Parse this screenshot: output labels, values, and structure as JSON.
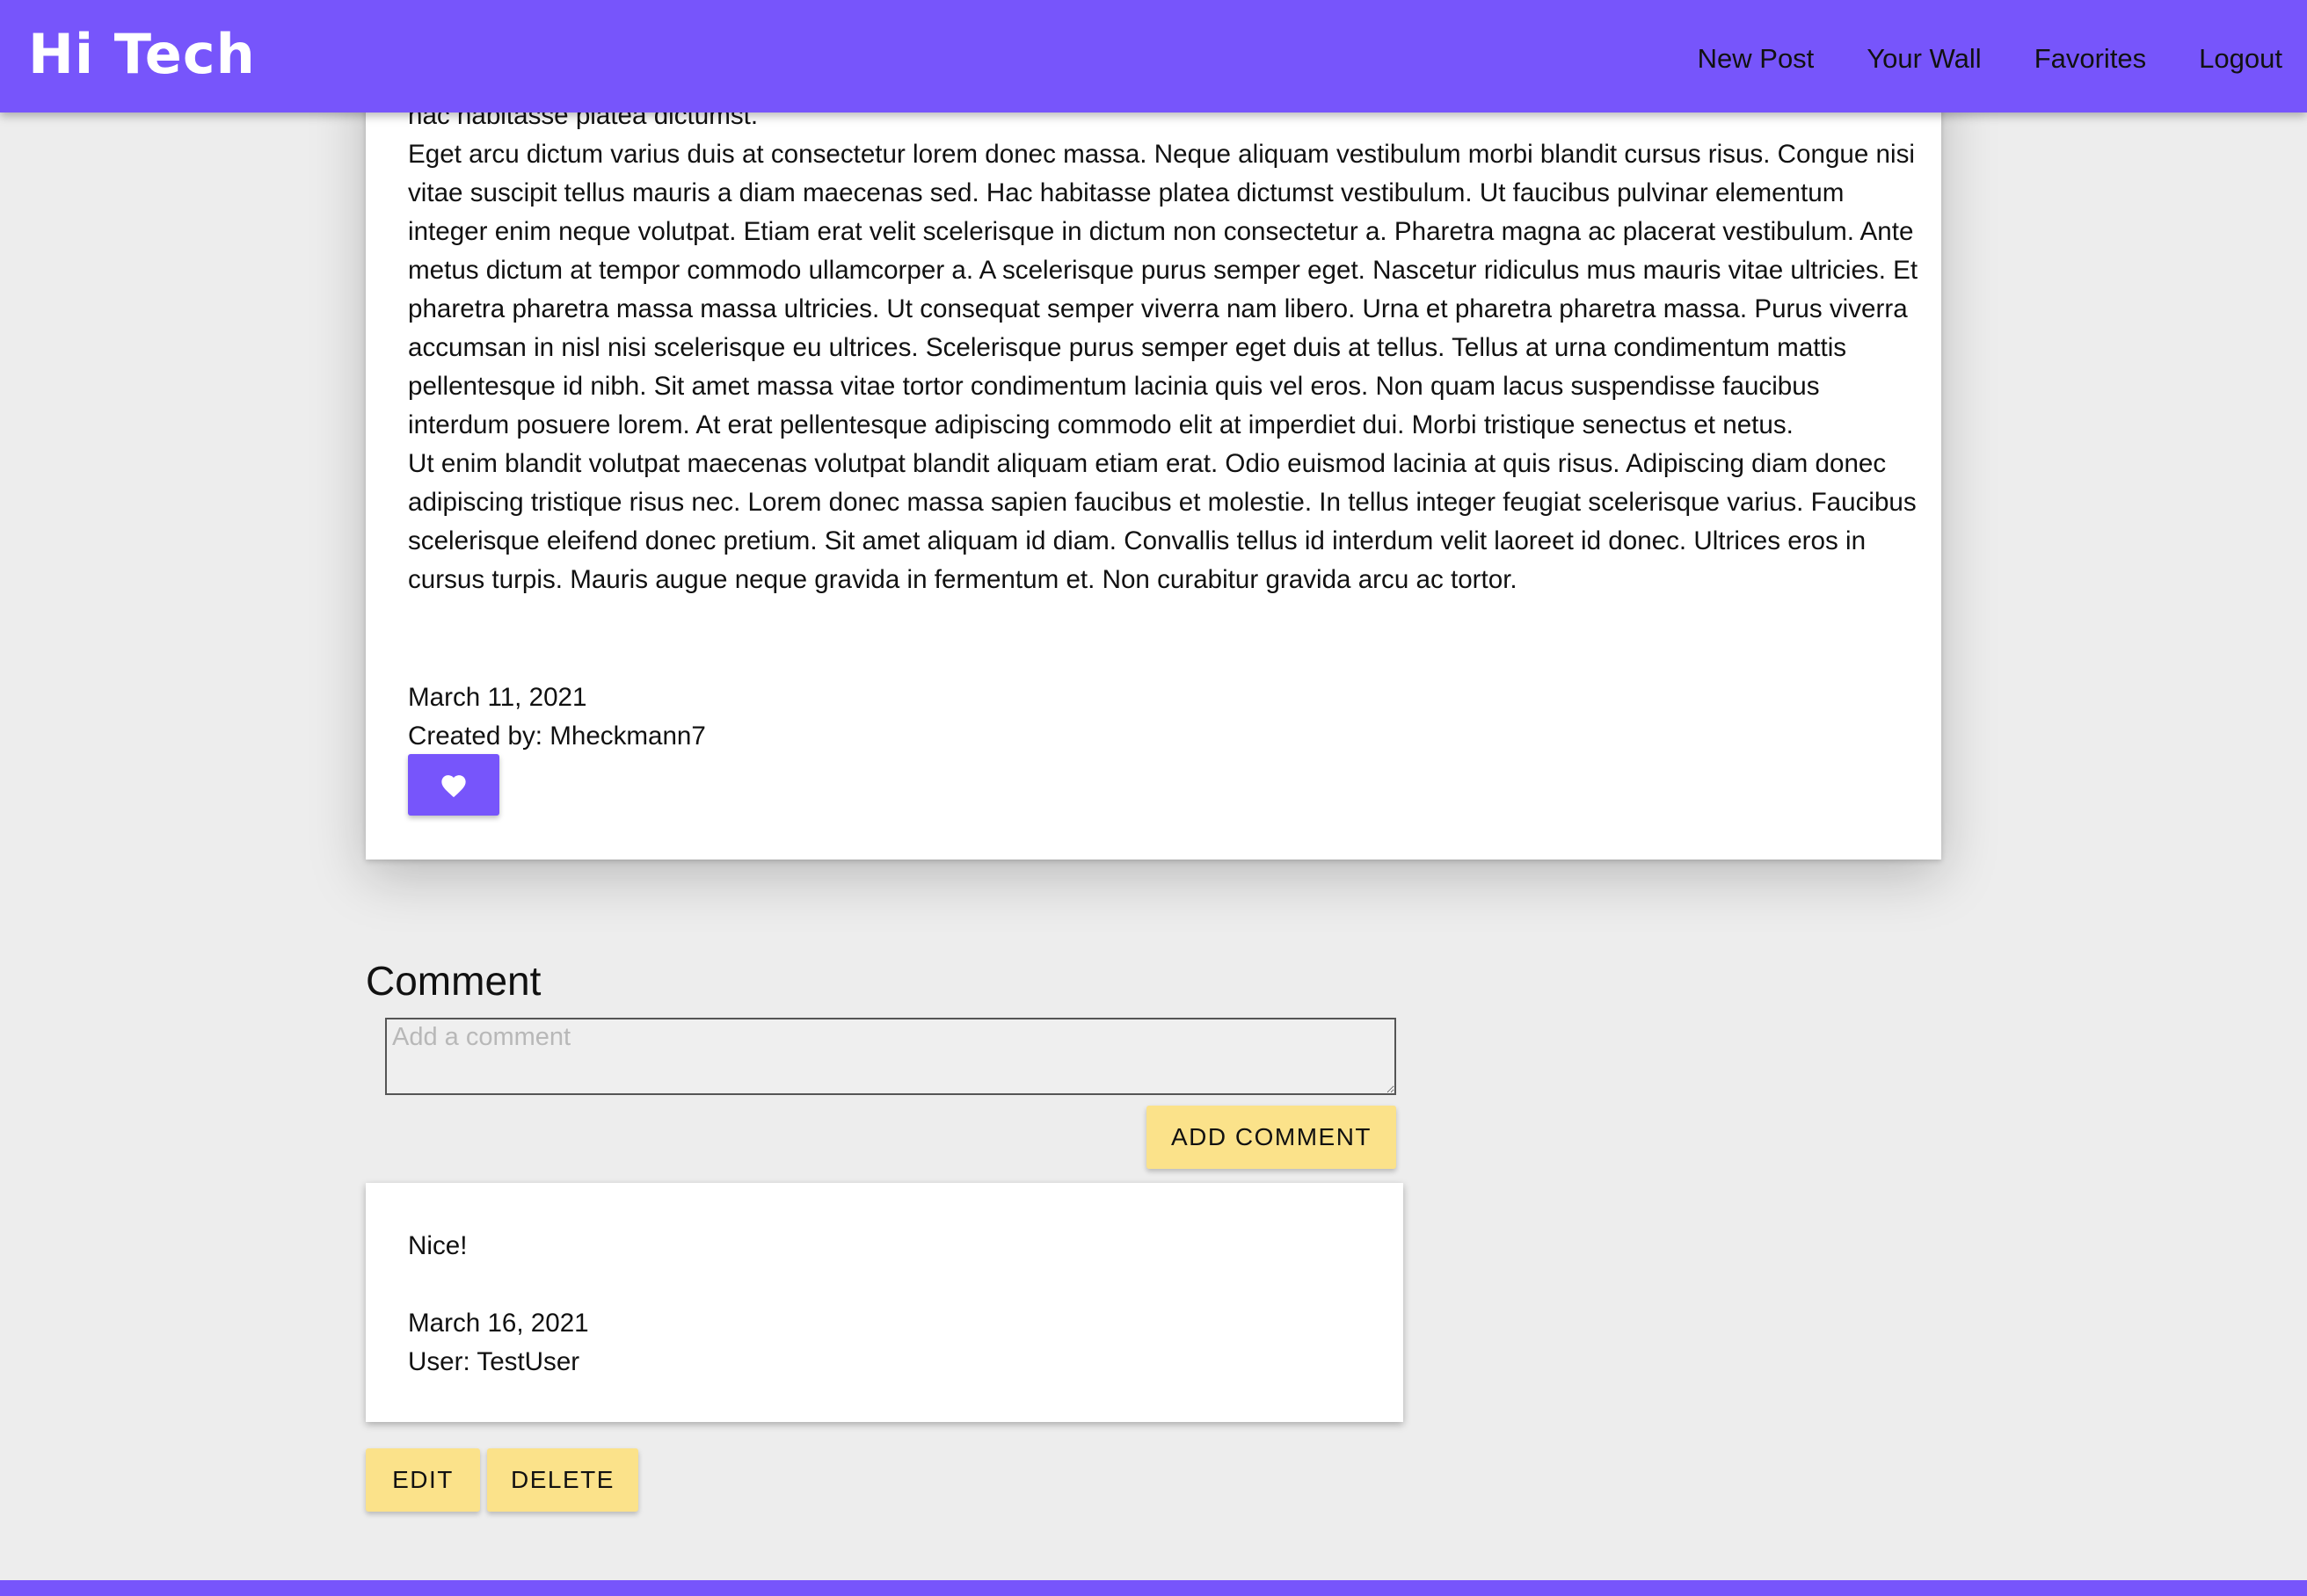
{
  "header": {
    "brand": "Hi Tech",
    "nav": [
      "New Post",
      "Your Wall",
      "Favorites",
      "Logout"
    ]
  },
  "post": {
    "paragraphs": [
      "hac habitasse platea dictumst.",
      "Eget arcu dictum varius duis at consectetur lorem donec massa. Neque aliquam vestibulum morbi blandit cursus risus. Congue nisi vitae suscipit tellus mauris a diam maecenas sed. Hac habitasse platea dictumst vestibulum. Ut faucibus pulvinar elementum integer enim neque volutpat. Etiam erat velit scelerisque in dictum non consectetur a. Pharetra magna ac placerat vestibulum. Ante metus dictum at tempor commodo ullamcorper a. A scelerisque purus semper eget. Nascetur ridiculus mus mauris vitae ultricies. Et pharetra pharetra massa massa ultricies. Ut consequat semper viverra nam libero. Urna et pharetra pharetra massa. Purus viverra accumsan in nisl nisi scelerisque eu ultrices. Scelerisque purus semper eget duis at tellus. Tellus at urna condimentum mattis pellentesque id nibh. Sit amet massa vitae tortor condimentum lacinia quis vel eros. Non quam lacus suspendisse faucibus interdum posuere lorem. At erat pellentesque adipiscing commodo elit at imperdiet dui. Morbi tristique senectus et netus.",
      "Ut enim blandit volutpat maecenas volutpat blandit aliquam etiam erat. Odio euismod lacinia at quis risus. Adipiscing diam donec adipiscing tristique risus nec. Lorem donec massa sapien faucibus et molestie. In tellus integer feugiat scelerisque varius. Faucibus scelerisque eleifend donec pretium. Sit amet aliquam id diam. Convallis tellus id interdum velit laoreet id donec. Ultrices eros in cursus turpis. Mauris augue neque gravida in fermentum et. Non curabitur gravida arcu ac tortor."
    ],
    "date": "March 11, 2021",
    "created_by": "Created by: Mheckmann7",
    "favorite_icon": "heart-icon"
  },
  "comment_section": {
    "heading": "Comment",
    "input_placeholder": "Add a comment",
    "input_value": "",
    "add_button": "ADD COMMENT"
  },
  "comments": [
    {
      "text": "Nice!",
      "date": "March 16, 2021",
      "user": "User: TestUser",
      "edit_label": "EDIT",
      "delete_label": "DELETE"
    }
  ],
  "colors": {
    "brand": "#7755fb",
    "background": "#ededed",
    "button_yellow": "#fbe28a"
  }
}
